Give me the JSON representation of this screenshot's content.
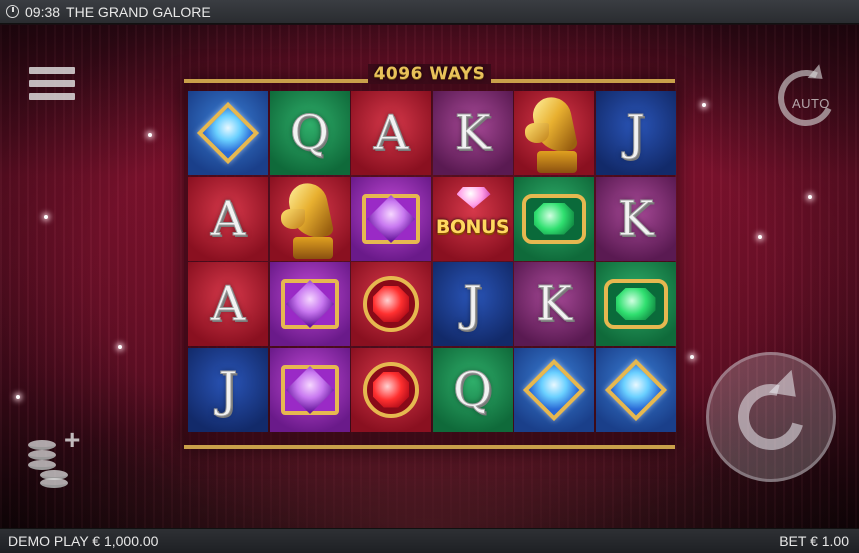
{
  "status_bar": {
    "time": "09:38",
    "title": "THE GRAND GALORE"
  },
  "banner": {
    "ways": "4096 WAYS"
  },
  "controls": {
    "auto_label": "AUTO"
  },
  "footer": {
    "balance": "DEMO PLAY € 1,000.00",
    "bet": "BET € 1.00"
  },
  "reels": [
    [
      {
        "symbol": "blue-diamond",
        "bg": "blue"
      },
      {
        "symbol": "A",
        "bg": "red"
      },
      {
        "symbol": "A",
        "bg": "red"
      },
      {
        "symbol": "J",
        "bg": "navy"
      }
    ],
    [
      {
        "symbol": "Q",
        "bg": "green"
      },
      {
        "symbol": "horse",
        "bg": "red"
      },
      {
        "symbol": "purple-gem",
        "bg": "purple"
      },
      {
        "symbol": "purple-gem",
        "bg": "purple"
      }
    ],
    [
      {
        "symbol": "A",
        "bg": "red"
      },
      {
        "symbol": "purple-gem",
        "bg": "purple"
      },
      {
        "symbol": "red-gem",
        "bg": "red"
      },
      {
        "symbol": "red-gem",
        "bg": "red"
      }
    ],
    [
      {
        "symbol": "K",
        "bg": "pink"
      },
      {
        "symbol": "BONUS",
        "bg": "red"
      },
      {
        "symbol": "J",
        "bg": "navy"
      },
      {
        "symbol": "Q",
        "bg": "green"
      }
    ],
    [
      {
        "symbol": "horse",
        "bg": "red"
      },
      {
        "symbol": "green-gem",
        "bg": "green"
      },
      {
        "symbol": "K",
        "bg": "pink"
      },
      {
        "symbol": "blue-diamond",
        "bg": "blue"
      }
    ],
    [
      {
        "symbol": "J",
        "bg": "navy"
      },
      {
        "symbol": "K",
        "bg": "pink"
      },
      {
        "symbol": "green-gem",
        "bg": "green"
      },
      {
        "symbol": "blue-diamond",
        "bg": "blue"
      }
    ]
  ]
}
